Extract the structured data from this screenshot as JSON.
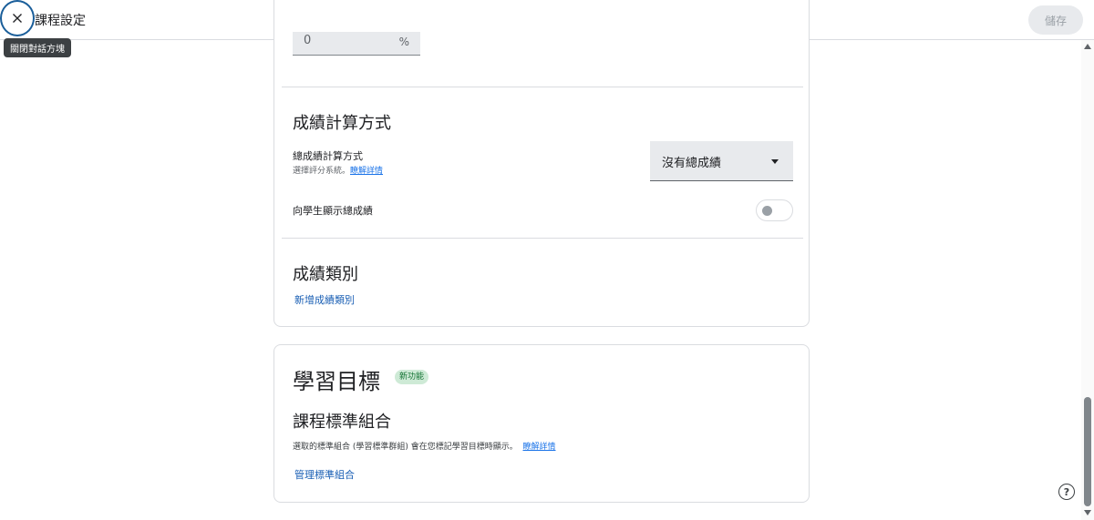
{
  "header": {
    "title": "課程設定",
    "close_tooltip": "關閉對話方塊",
    "save_label": "儲存"
  },
  "grading": {
    "percent_value": "0",
    "percent_suffix": "%",
    "title": "成績計算方式",
    "calc_label": "總成績計算方式",
    "calc_desc": "選擇評分系統。",
    "learn_more": "瞭解詳情",
    "calc_select_value": "沒有總成績",
    "show_overall_label": "向學生顯示總成績",
    "show_overall_enabled": false
  },
  "categories": {
    "title": "成績類別",
    "add_label": "新增成績類別"
  },
  "objectives": {
    "title": "學習目標",
    "new_badge": "新功能",
    "standards_title": "課程標準組合",
    "standards_desc": "選取的標準組合 (學習標準群組) 會在您標記學習目標時顯示。",
    "learn_more": "瞭解詳情",
    "manage_label": "管理標準組合"
  },
  "help": {
    "icon_glyph": "?"
  },
  "colors": {
    "link": "#1a73e8",
    "focus_ring": "#1a5e9a",
    "badge_bg": "#ceead6",
    "badge_text": "#137333"
  }
}
